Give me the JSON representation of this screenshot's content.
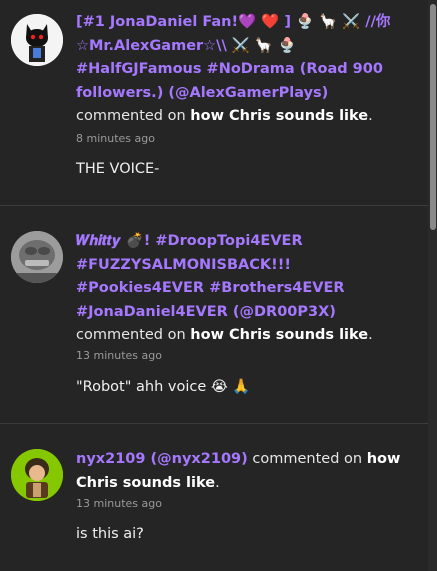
{
  "comments": [
    {
      "user_line1": "[#1 JonaDaniel Fan!💜 ❤️ ] 🍨 🦙 ⚔️ //你",
      "user_line2": "☆Mr.AlexGamer☆\\\\ ⚔️ 🦙 🍨",
      "user_line3": "#HalfGJFamous #NoDrama (Road 900",
      "user_line4": "followers.) (@AlexGamerPlays)",
      "action": "commented on",
      "story": "how Chris sounds like",
      "time": "8 minutes ago",
      "body": "THE VOICE-"
    },
    {
      "user_line1": "𝑾𝒉𝒊𝒕𝒕𝒚 💣! #DroopTopi4EVER",
      "user_line2": "#FUZZYSALMONISBACK!!!",
      "user_line3": "#Pookies4EVER #Brothers4EVER",
      "user_line4": "#JonaDaniel4EVER (@DR00P3X)",
      "action": "commented on",
      "story": "how Chris sounds like",
      "time": "13 minutes ago",
      "body": "\"Robot\" ahh voice 😭 🙏"
    },
    {
      "user": "nyx2109 (@nyx2109)",
      "action": "commented on",
      "story_part1": "how",
      "story_part2": "Chris sounds like",
      "time": "13 minutes ago",
      "body": "is this ai?"
    }
  ],
  "period": "."
}
